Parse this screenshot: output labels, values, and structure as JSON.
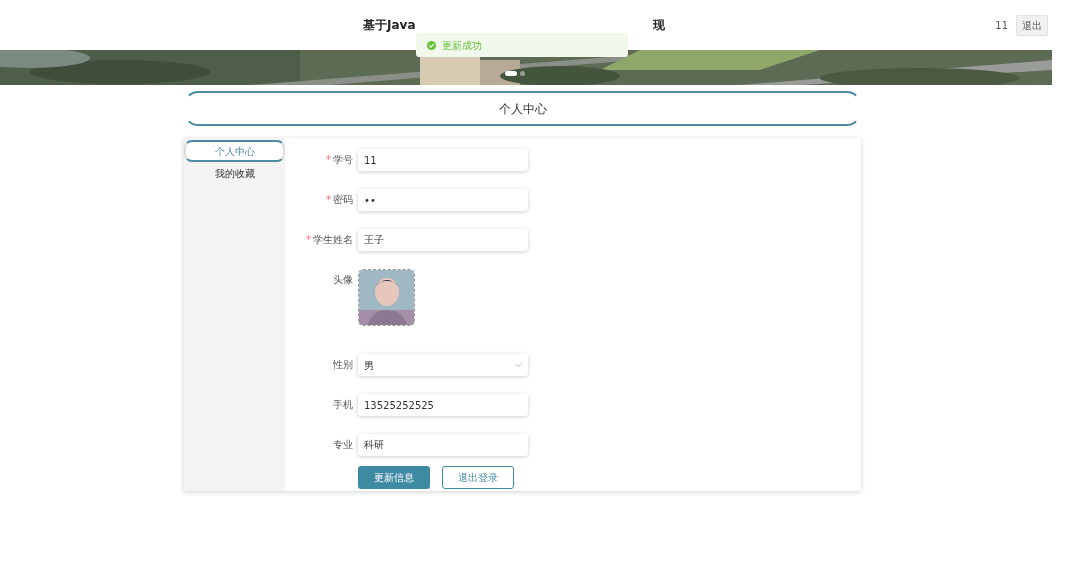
{
  "header": {
    "title_start": "基于Java",
    "title_end": "现",
    "user": "11",
    "logout": "退出"
  },
  "toast": {
    "message": "更新成功"
  },
  "banner": {
    "slides": [
      {
        "selected": true
      },
      {
        "selected": false
      }
    ]
  },
  "page_title": "个人中心",
  "sidebar": {
    "items": [
      {
        "label": "个人中心",
        "selected": true
      },
      {
        "label": "我的收藏",
        "selected": false
      }
    ]
  },
  "form": {
    "fields": [
      {
        "kind": "text",
        "required_mark": "*",
        "label": "学号",
        "value": "11"
      },
      {
        "kind": "text",
        "required_mark": "*",
        "label": "密码",
        "value": "••"
      },
      {
        "kind": "text",
        "required_mark": "*",
        "label": "学生姓名",
        "value": "王子"
      },
      {
        "label": "头像"
      },
      {
        "kind": "select",
        "label": "性别",
        "value": "男"
      },
      {
        "kind": "text",
        "label": "手机",
        "value": "13525252525"
      },
      {
        "kind": "text",
        "label": "专业",
        "value": "科研"
      }
    ]
  },
  "buttons": [
    {
      "label": "更新信息",
      "kind": "primary"
    },
    {
      "label": "退出登录",
      "kind": "outline"
    }
  ]
}
